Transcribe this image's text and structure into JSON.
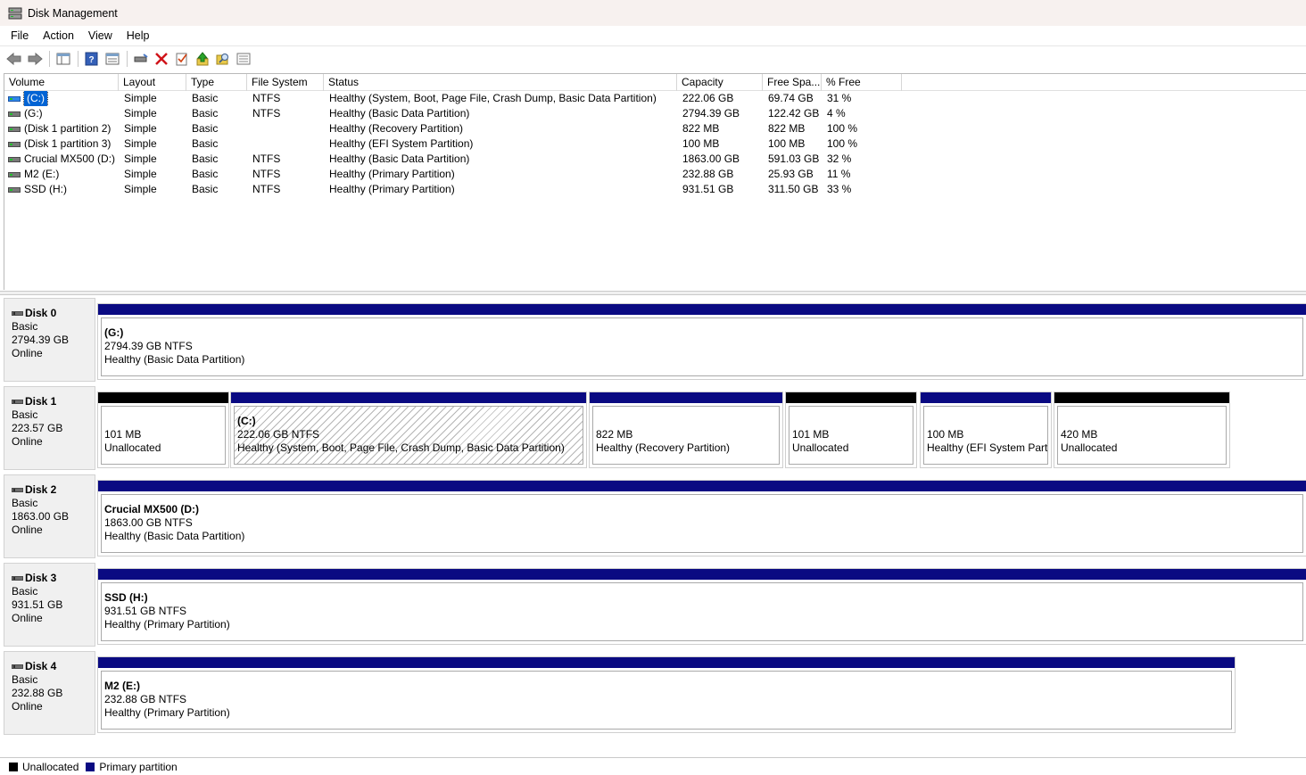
{
  "window": {
    "title": "Disk Management"
  },
  "menu": [
    "File",
    "Action",
    "View",
    "Help"
  ],
  "toolbar": [
    "back-icon",
    "forward-icon",
    "show-hide-console-tree-icon",
    "help-icon",
    "properties-icon",
    "connect-disk-icon",
    "delete-icon",
    "checklist-icon",
    "move-up-icon",
    "search-icon",
    "details-icon"
  ],
  "list": {
    "columns": [
      "Volume",
      "Layout",
      "Type",
      "File System",
      "Status",
      "Capacity",
      "Free Spa...",
      "% Free"
    ],
    "rows": [
      {
        "volume": "(C:)",
        "layout": "Simple",
        "type": "Basic",
        "fs": "NTFS",
        "status": "Healthy (System, Boot, Page File, Crash Dump, Basic Data Partition)",
        "capacity": "222.06 GB",
        "free": "69.74 GB",
        "pct": "31 %",
        "selected": true
      },
      {
        "volume": "(G:)",
        "layout": "Simple",
        "type": "Basic",
        "fs": "NTFS",
        "status": "Healthy (Basic Data Partition)",
        "capacity": "2794.39 GB",
        "free": "122.42 GB",
        "pct": "4 %"
      },
      {
        "volume": "(Disk 1 partition 2)",
        "layout": "Simple",
        "type": "Basic",
        "fs": "",
        "status": "Healthy (Recovery Partition)",
        "capacity": "822 MB",
        "free": "822 MB",
        "pct": "100 %"
      },
      {
        "volume": "(Disk 1 partition 3)",
        "layout": "Simple",
        "type": "Basic",
        "fs": "",
        "status": "Healthy (EFI System Partition)",
        "capacity": "100 MB",
        "free": "100 MB",
        "pct": "100 %"
      },
      {
        "volume": "Crucial MX500 (D:)",
        "layout": "Simple",
        "type": "Basic",
        "fs": "NTFS",
        "status": "Healthy (Basic Data Partition)",
        "capacity": "1863.00 GB",
        "free": "591.03 GB",
        "pct": "32 %"
      },
      {
        "volume": "M2 (E:)",
        "layout": "Simple",
        "type": "Basic",
        "fs": "NTFS",
        "status": "Healthy (Primary Partition)",
        "capacity": "232.88 GB",
        "free": "25.93 GB",
        "pct": "11 %"
      },
      {
        "volume": "SSD (H:)",
        "layout": "Simple",
        "type": "Basic",
        "fs": "NTFS",
        "status": "Healthy (Primary Partition)",
        "capacity": "931.51 GB",
        "free": "311.50 GB",
        "pct": "33 %"
      }
    ]
  },
  "disks": [
    {
      "name": "Disk 0",
      "type": "Basic",
      "size": "2794.39 GB",
      "status": "Online",
      "partitions": [
        {
          "kind": "primary",
          "name": "(G:)",
          "size": "2794.39 GB NTFS",
          "status": "Healthy (Basic Data Partition)"
        }
      ]
    },
    {
      "name": "Disk 1",
      "type": "Basic",
      "size": "223.57 GB",
      "status": "Online",
      "partitions": [
        {
          "kind": "unallocated",
          "name": "",
          "size": "101 MB",
          "status": "Unallocated"
        },
        {
          "kind": "primary",
          "name": "(C:)",
          "size": "222.06 GB NTFS",
          "status": "Healthy (System, Boot, Page File, Crash Dump, Basic Data Partition)",
          "selected": true
        },
        {
          "kind": "primary",
          "name": "",
          "size": "822 MB",
          "status": "Healthy (Recovery Partition)"
        },
        {
          "kind": "unallocated",
          "name": "",
          "size": "101 MB",
          "status": "Unallocated"
        },
        {
          "kind": "primary",
          "name": "",
          "size": "100 MB",
          "status": "Healthy (EFI System Partit"
        },
        {
          "kind": "unallocated",
          "name": "",
          "size": "420 MB",
          "status": "Unallocated"
        }
      ]
    },
    {
      "name": "Disk 2",
      "type": "Basic",
      "size": "1863.00 GB",
      "status": "Online",
      "partitions": [
        {
          "kind": "primary",
          "name": "Crucial MX500  (D:)",
          "size": "1863.00 GB NTFS",
          "status": "Healthy (Basic Data Partition)"
        }
      ]
    },
    {
      "name": "Disk 3",
      "type": "Basic",
      "size": "931.51 GB",
      "status": "Online",
      "partitions": [
        {
          "kind": "primary",
          "name": "SSD  (H:)",
          "size": "931.51 GB NTFS",
          "status": "Healthy (Primary Partition)"
        }
      ]
    },
    {
      "name": "Disk 4",
      "type": "Basic",
      "size": "232.88 GB",
      "status": "Online",
      "partitions": [
        {
          "kind": "primary",
          "name": "M2  (E:)",
          "size": "232.88 GB NTFS",
          "status": "Healthy (Primary Partition)"
        }
      ]
    }
  ],
  "legend": [
    {
      "label": "Unallocated",
      "color": "#000000"
    },
    {
      "label": "Primary partition",
      "color": "#0a0a82"
    }
  ]
}
